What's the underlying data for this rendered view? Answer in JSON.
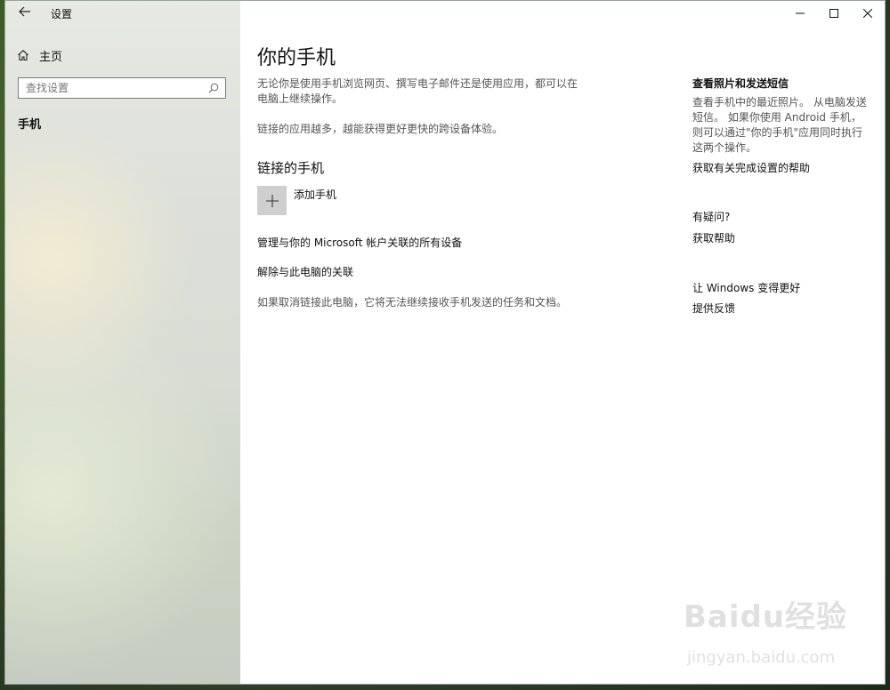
{
  "window": {
    "app_title": "设置",
    "controls": {
      "minimize_icon": "minimize-icon",
      "maximize_icon": "maximize-icon",
      "close_icon": "close-icon"
    }
  },
  "sidebar": {
    "back_icon": "back-arrow-icon",
    "home": {
      "icon": "home-icon",
      "label": "主页"
    },
    "search": {
      "placeholder": "查找设置",
      "icon": "search-icon"
    },
    "active_item": "手机"
  },
  "main": {
    "title": "你的手机",
    "description": "无论你是使用手机浏览网页、撰写电子邮件还是使用应用，都可以在电脑上继续操作。",
    "description2": "链接的应用越多，越能获得更好更快的跨设备体验。",
    "linked_section_title": "链接的手机",
    "add_phone": {
      "icon": "plus-icon",
      "label": "添加手机"
    },
    "manage_link": "管理与你的 Microsoft 帐户关联的所有设备",
    "unlink_link": "解除与此电脑的关联",
    "unlink_note": "如果取消链接此电脑，它将无法继续接收手机发送的任务和文档。"
  },
  "aside": {
    "photos_title": "查看照片和发送短信",
    "photos_text": "查看手机中的最近照片。 从电脑发送短信。 如果你使用 Android 手机，则可以通过\"你的手机\"应用同时执行这两个操作。",
    "setup_help_link": "获取有关完成设置的帮助",
    "question_title": "有疑问?",
    "get_help_link": "获取帮助",
    "feedback_title": "让 Windows 变得更好",
    "feedback_link": "提供反馈"
  },
  "watermark": {
    "logo": "Baidu经验",
    "url": "jingyan.baidu.com"
  },
  "colors": {
    "sidebar_bg": "#dde0d9",
    "tile_bg": "#cfcfcf",
    "text_secondary": "#555555"
  }
}
